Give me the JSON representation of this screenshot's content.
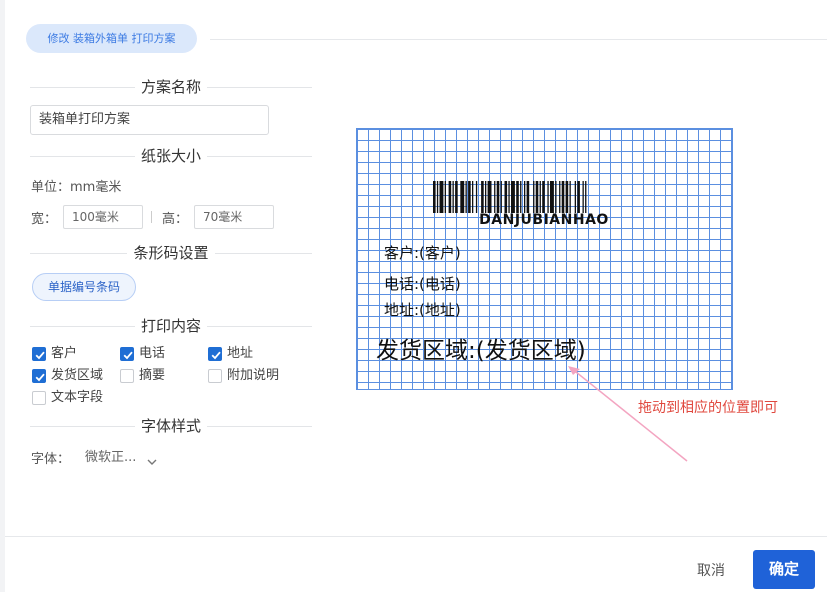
{
  "dialog": {
    "title": "修改 装箱外箱单 打印方案"
  },
  "sections": {
    "scheme_name": "方案名称",
    "paper_size": "纸张大小",
    "barcode_settings": "条形码设置",
    "print_content": "打印内容",
    "font_style": "字体样式"
  },
  "scheme": {
    "name_value": "装箱单打印方案"
  },
  "paper": {
    "unit_text": "单位：mm毫米",
    "width_label": "宽：",
    "width_value": "100毫米",
    "height_label": "高：",
    "height_value": "70毫米"
  },
  "barcode": {
    "button_label": "单据编号条码"
  },
  "print_options": [
    {
      "label": "客户",
      "checked": true
    },
    {
      "label": "电话",
      "checked": true
    },
    {
      "label": "地址",
      "checked": true
    },
    {
      "label": "发货区域",
      "checked": true
    },
    {
      "label": "摘要",
      "checked": false
    },
    {
      "label": "附加说明",
      "checked": false
    },
    {
      "label": "文本字段",
      "checked": false
    }
  ],
  "font": {
    "label": "字体：",
    "value": "微软正..."
  },
  "preview": {
    "barcode_text": "DANJUBIANHAO",
    "customer": "客户:(客户)",
    "phone": "电话:(电话)",
    "address": "地址:(地址)",
    "region": "发货区域:(发货区域)"
  },
  "annotation": {
    "hint": "拖动到相应的位置即可",
    "color": "#e0483e"
  },
  "footer": {
    "cancel_label": "取消",
    "ok_label": "确定"
  },
  "colors": {
    "accent": "#1f62d8",
    "grid": "#5b8fe0"
  },
  "icons": [
    "check-icon",
    "chevron-down-icon"
  ]
}
